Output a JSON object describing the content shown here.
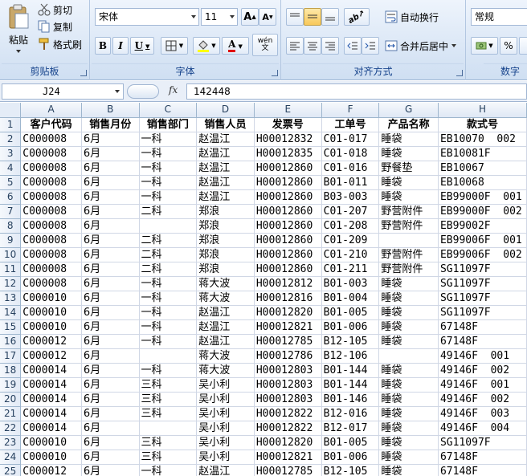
{
  "clipboard": {
    "paste": "粘贴",
    "cut": "剪切",
    "copy": "复制",
    "format_painter": "格式刷",
    "label": "剪贴板"
  },
  "font": {
    "name": "宋体",
    "size": "11",
    "bold": "B",
    "italic": "I",
    "underline": "U",
    "font_color": "A",
    "wen": "wén\n文",
    "label": "字体"
  },
  "alignment": {
    "wrap": "自动换行",
    "merge": "合并后居中",
    "label": "对齐方式"
  },
  "number": {
    "format": "常规",
    "percent": "%",
    "label": "数字"
  },
  "formula_bar": {
    "name_box": "J24",
    "fx": "fx",
    "value": "142448"
  },
  "columns": [
    "A",
    "B",
    "C",
    "D",
    "E",
    "F",
    "G",
    "H"
  ],
  "header_row": [
    "客户代码",
    "销售月份",
    "销售部门",
    "销售人员",
    "发票号",
    "工单号",
    "产品名称",
    "款式号"
  ],
  "rows": [
    [
      "C000008",
      "6月",
      "一科",
      "赵温江",
      "H00012832",
      "C01-017",
      "睡袋",
      "EB10070  002"
    ],
    [
      "C000008",
      "6月",
      "一科",
      "赵温江",
      "H00012835",
      "C01-018",
      "睡袋",
      "EB10081F"
    ],
    [
      "C000008",
      "6月",
      "一科",
      "赵温江",
      "H00012860",
      "C01-016",
      "野餐垫",
      "EB10067"
    ],
    [
      "C000008",
      "6月",
      "一科",
      "赵温江",
      "H00012860",
      "B01-011",
      "睡袋",
      "EB10068"
    ],
    [
      "C000008",
      "6月",
      "一科",
      "赵温江",
      "H00012860",
      "B03-003",
      "睡袋",
      "EB99000F  001"
    ],
    [
      "C000008",
      "6月",
      "二科",
      "郑浪",
      "H00012860",
      "C01-207",
      "野营附件",
      "EB99000F  002"
    ],
    [
      "C000008",
      "6月",
      "",
      "郑浪",
      "H00012860",
      "C01-208",
      "野营附件",
      "EB99002F"
    ],
    [
      "C000008",
      "6月",
      "二科",
      "郑浪",
      "H00012860",
      "C01-209",
      "",
      "EB99006F  001"
    ],
    [
      "C000008",
      "6月",
      "二科",
      "郑浪",
      "H00012860",
      "C01-210",
      "野营附件",
      "EB99006F  002"
    ],
    [
      "C000008",
      "6月",
      "二科",
      "郑浪",
      "H00012860",
      "C01-211",
      "野营附件",
      "SG11097F"
    ],
    [
      "C000008",
      "6月",
      "一科",
      "蒋大波",
      "H00012812",
      "B01-003",
      "睡袋",
      "SG11097F"
    ],
    [
      "C000010",
      "6月",
      "一科",
      "蒋大波",
      "H00012816",
      "B01-004",
      "睡袋",
      "SG11097F"
    ],
    [
      "C000010",
      "6月",
      "一科",
      "赵温江",
      "H00012820",
      "B01-005",
      "睡袋",
      "SG11097F"
    ],
    [
      "C000010",
      "6月",
      "一科",
      "赵温江",
      "H00012821",
      "B01-006",
      "睡袋",
      "67148F"
    ],
    [
      "C000012",
      "6月",
      "一科",
      "赵温江",
      "H00012785",
      "B12-105",
      "睡袋",
      "67148F"
    ],
    [
      "C000012",
      "6月",
      "",
      "蒋大波",
      "H00012786",
      "B12-106",
      "",
      "49146F  001"
    ],
    [
      "C000014",
      "6月",
      "一科",
      "蒋大波",
      "H00012803",
      "B01-144",
      "睡袋",
      "49146F  002"
    ],
    [
      "C000014",
      "6月",
      "三科",
      "吴小利",
      "H00012803",
      "B01-144",
      "睡袋",
      "49146F  001"
    ],
    [
      "C000014",
      "6月",
      "三科",
      "吴小利",
      "H00012803",
      "B01-146",
      "睡袋",
      "49146F  002"
    ],
    [
      "C000014",
      "6月",
      "三科",
      "吴小利",
      "H00012822",
      "B12-016",
      "睡袋",
      "49146F  003"
    ],
    [
      "C000014",
      "6月",
      "",
      "吴小利",
      "H00012822",
      "B12-017",
      "睡袋",
      "49146F  004"
    ],
    [
      "C000010",
      "6月",
      "三科",
      "吴小利",
      "H00012820",
      "B01-005",
      "睡袋",
      "SG11097F"
    ],
    [
      "C000010",
      "6月",
      "三科",
      "吴小利",
      "H00012821",
      "B01-006",
      "睡袋",
      "67148F"
    ],
    [
      "C000012",
      "6月",
      "一科",
      "赵温江",
      "H00012785",
      "B12-105",
      "睡袋",
      "67148F"
    ]
  ]
}
